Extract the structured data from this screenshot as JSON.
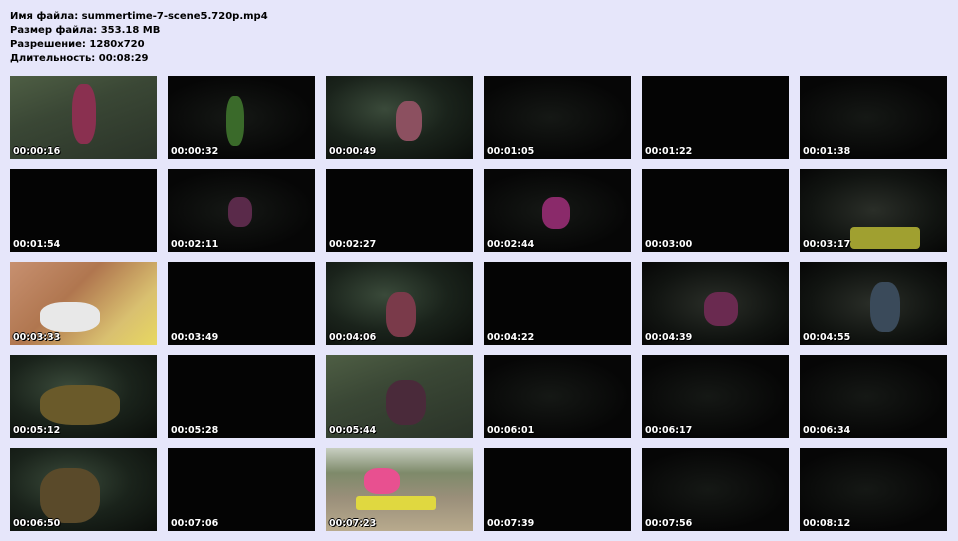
{
  "info": {
    "filename": "Имя файла: summertime-7-scene5.720p.mp4",
    "filesize": "Размер файла: 353.18 MB",
    "resolution": "Разрешение: 1280x720",
    "duration": "Длительность: 00:08:29"
  },
  "thumbnails": [
    {
      "time": "00:00:16"
    },
    {
      "time": "00:00:32"
    },
    {
      "time": "00:00:49"
    },
    {
      "time": "00:01:05"
    },
    {
      "time": "00:01:22"
    },
    {
      "time": "00:01:38"
    },
    {
      "time": "00:01:54"
    },
    {
      "time": "00:02:11"
    },
    {
      "time": "00:02:27"
    },
    {
      "time": "00:02:44"
    },
    {
      "time": "00:03:00"
    },
    {
      "time": "00:03:17"
    },
    {
      "time": "00:03:33"
    },
    {
      "time": "00:03:49"
    },
    {
      "time": "00:04:06"
    },
    {
      "time": "00:04:22"
    },
    {
      "time": "00:04:39"
    },
    {
      "time": "00:04:55"
    },
    {
      "time": "00:05:12"
    },
    {
      "time": "00:05:28"
    },
    {
      "time": "00:05:44"
    },
    {
      "time": "00:06:01"
    },
    {
      "time": "00:06:17"
    },
    {
      "time": "00:06:34"
    },
    {
      "time": "00:06:50"
    },
    {
      "time": "00:07:06"
    },
    {
      "time": "00:07:23"
    },
    {
      "time": "00:07:39"
    },
    {
      "time": "00:07:56"
    },
    {
      "time": "00:08:12"
    }
  ]
}
